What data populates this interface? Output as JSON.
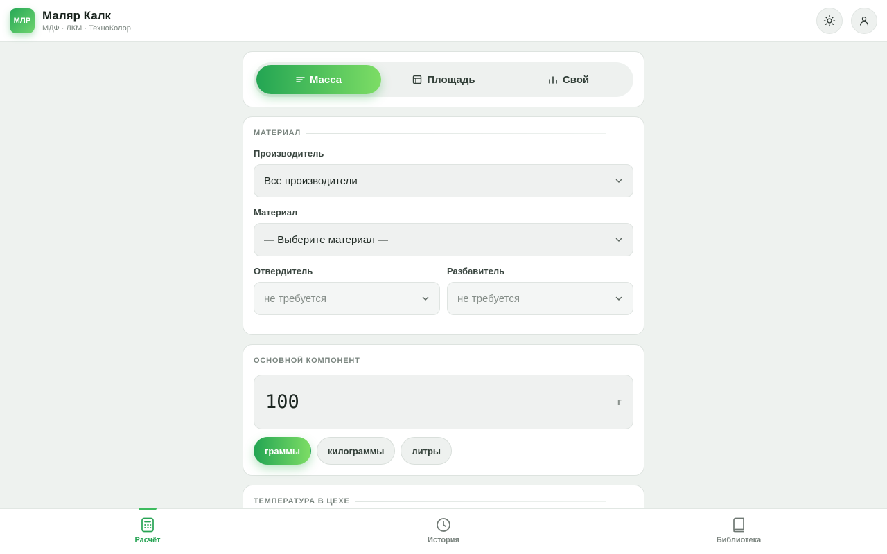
{
  "header": {
    "logo_text": "МЛР",
    "title": "Маляр Калк",
    "subtitle": "МДФ · ЛКМ · ТехноКолор",
    "theme_icon": "sun-icon",
    "profile_icon": "user-icon"
  },
  "mode_tabs": [
    {
      "label": "Масса",
      "icon": "lines-icon",
      "active": true
    },
    {
      "label": "Площадь",
      "icon": "square-grid-icon",
      "active": false
    },
    {
      "label": "Свой",
      "icon": "bar-chart-icon",
      "active": false
    }
  ],
  "material": {
    "section_title": "МАТЕРИАЛ",
    "manufacturer_label": "Производитель",
    "manufacturer_value": "Все производители",
    "material_label": "Материал",
    "material_value": "— Выберите материал —",
    "hardener_label": "Отвердитель",
    "hardener_value": "не требуется",
    "thinner_label": "Разбавитель",
    "thinner_value": "не требуется"
  },
  "component": {
    "section_title": "ОСНОВНОЙ КОМПОНЕНТ",
    "amount": "100",
    "unit": "г",
    "unit_options": [
      {
        "label": "граммы",
        "active": true
      },
      {
        "label": "килограммы",
        "active": false
      },
      {
        "label": "литры",
        "active": false
      }
    ]
  },
  "temperature": {
    "section_title": "ТЕМПЕРАТУРА В ЦЕХЕ"
  },
  "bottom_nav": [
    {
      "label": "Расчёт",
      "icon": "calculator-icon",
      "active": true
    },
    {
      "label": "История",
      "icon": "clock-icon",
      "active": false
    },
    {
      "label": "Библиотека",
      "icon": "book-icon",
      "active": false
    }
  ],
  "colors": {
    "accent": "#27a454",
    "accent_light": "#7ddd65",
    "background": "#eef2ef"
  }
}
